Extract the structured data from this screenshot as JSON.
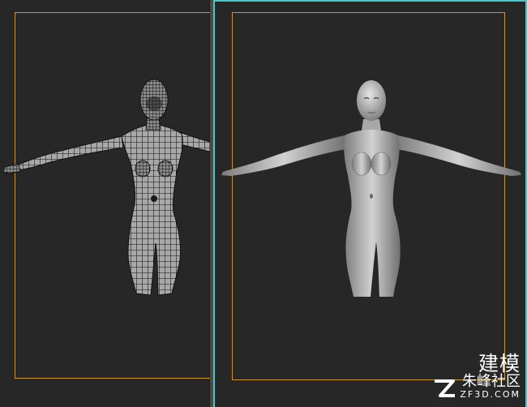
{
  "viewports": [
    {
      "id": "left",
      "mode": "wireframe",
      "active": false
    },
    {
      "id": "right",
      "mode": "shaded",
      "active": true
    }
  ],
  "colors": {
    "background": "#272727",
    "safe_frame": "#c8962e",
    "active_border": "#48c7c7",
    "wire": "#0e0e0e",
    "mesh_fill": "#9a9a9a"
  },
  "watermark": {
    "title": "建模",
    "subtitle": "朱峰社区",
    "url": "ZF3D.COM",
    "logo_icon": "zf-logo-icon"
  }
}
